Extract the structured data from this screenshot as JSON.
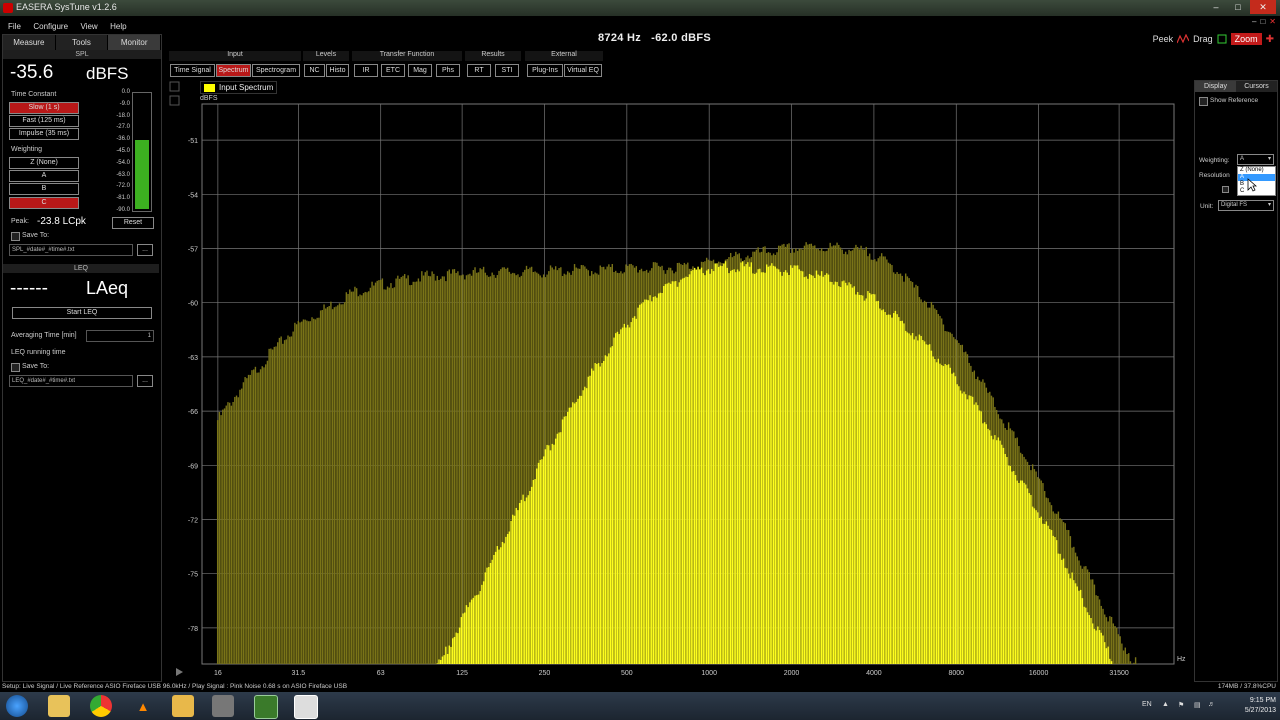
{
  "window": {
    "title": "EASERA SysTune v1.2.6"
  },
  "menu": [
    "File",
    "Configure",
    "View",
    "Help"
  ],
  "readout": {
    "freq": "8724 Hz",
    "level": "-62.0 dBFS"
  },
  "topright": {
    "peek": "Peek",
    "drag": "Drag",
    "zoom": "Zoom"
  },
  "left_tabs": [
    "Measure",
    "Tools",
    "Monitor"
  ],
  "spl": {
    "section": "SPL",
    "value": "-35.6",
    "unit": "dBFS",
    "time_constant_label": "Time Constant",
    "time_constants": [
      "Slow (1 s)",
      "Fast (125 ms)",
      "Impulse (35 ms)"
    ],
    "weighting_label": "Weighting",
    "weightings": [
      "Z (None)",
      "A",
      "B",
      "C"
    ],
    "peak_label": "Peak:",
    "peak_value": "-23.8 LCpk",
    "reset": "Reset",
    "save_to": "Save To:",
    "file": "SPL_#date#_#time#.txt",
    "browse": "...",
    "meter_ticks": [
      "0.0",
      "-9.0",
      "-18.0",
      "-27.0",
      "-36.0",
      "-45.0",
      "-54.0",
      "-63.0",
      "-72.0",
      "-81.0",
      "-90.0"
    ],
    "meter_level_dbfs": -35.6
  },
  "leq": {
    "section": "LEQ",
    "value": "------",
    "unit": "LAeq",
    "start": "Start LEQ",
    "avg_label": "Averaging Time [min]",
    "avg_value": "1",
    "running": "LEQ running time",
    "save_to": "Save To:",
    "file": "LEQ_#date#_#time#.txt",
    "browse": "..."
  },
  "toolbar": {
    "groups": [
      {
        "label": "Input",
        "buttons": [
          "Time Signal",
          "Spectrum",
          "Spectrogram"
        ],
        "active": "Spectrum"
      },
      {
        "label": "Levels",
        "buttons": [
          "NC",
          "Histo"
        ]
      },
      {
        "label": "Transfer Function",
        "buttons": [
          "IR",
          "ETC",
          "Mag",
          "Phs"
        ]
      },
      {
        "label": "Results",
        "buttons": [
          "RT",
          "STI"
        ]
      },
      {
        "label": "External",
        "buttons": [
          "Plug-Ins",
          "Virtual EQ"
        ]
      }
    ]
  },
  "legend": {
    "label": "Input Spectrum"
  },
  "chart_data": {
    "type": "bar",
    "ylabel": "dBFS",
    "xlabel": "Hz",
    "x_scale": "log",
    "xlim": [
      14,
      50000
    ],
    "ylim": [
      -80,
      -49
    ],
    "x_ticks": [
      "16",
      "31.5",
      "63",
      "125",
      "250",
      "500",
      "1000",
      "2000",
      "4000",
      "8000",
      "16000",
      "31500"
    ],
    "y_ticks": [
      "-51",
      "-54",
      "-57",
      "-60",
      "-63",
      "-66",
      "-69",
      "-72",
      "-75",
      "-78"
    ],
    "series": [
      {
        "color": "#7a7418",
        "x": [
          16,
          20,
          25,
          31.5,
          40,
          50,
          63,
          80,
          100,
          125,
          160,
          200,
          250,
          315,
          400,
          500,
          630,
          800,
          1000,
          1250,
          1600,
          2000,
          2500,
          3150,
          4000,
          5000,
          6300,
          8000,
          10000,
          12500,
          16000,
          20000,
          25000,
          31500,
          40000
        ],
        "values": [
          -66.5,
          -64.5,
          -62.8,
          -61.2,
          -60.3,
          -59.4,
          -59.0,
          -58.7,
          -58.5,
          -58.4,
          -58.3,
          -58.3,
          -58.3,
          -58.2,
          -58.2,
          -58.1,
          -58.1,
          -58.0,
          -57.8,
          -57.5,
          -57.2,
          -57.0,
          -56.9,
          -57.0,
          -57.3,
          -58.3,
          -60.0,
          -62.0,
          -64.5,
          -67.0,
          -69.8,
          -72.5,
          -75.5,
          -78.5,
          -81
        ]
      },
      {
        "color": "#ffff1e",
        "x": [
          63,
          80,
          100,
          125,
          160,
          200,
          250,
          315,
          400,
          500,
          630,
          800,
          1000,
          1250,
          1600,
          2000,
          2500,
          3150,
          4000,
          5000,
          6300,
          8000,
          10000,
          12500,
          16000,
          20000,
          25000,
          31500,
          40000
        ],
        "values": [
          -90,
          -84,
          -80.5,
          -77.5,
          -74.5,
          -71.5,
          -68.5,
          -65.8,
          -63.2,
          -61.2,
          -59.6,
          -58.6,
          -58.1,
          -58.0,
          -58.1,
          -58.2,
          -58.5,
          -59.0,
          -59.8,
          -61.0,
          -62.4,
          -64.2,
          -66.3,
          -68.8,
          -71.5,
          -74.3,
          -77.5,
          -80.5,
          -84
        ]
      }
    ]
  },
  "right_panel": {
    "tabs": [
      "Display",
      "Cursors"
    ],
    "show_reference": "Show Reference",
    "weighting_label": "Weighting:",
    "weighting_value": "A",
    "resolution_label": "Resolution",
    "unit_label": "Unit:",
    "unit_value": "Digital FS",
    "dropdown_options": [
      "Z (None)",
      "A",
      "B",
      "C"
    ],
    "dropdown_selected": "A"
  },
  "status": {
    "left": "Setup: Live Signal / Live Reference ASIO Fireface USB 96.0kHz / Play Signal : Pink Noise 0.68 s on ASIO Fireface USB",
    "right": "174MB / 37.8%CPU"
  },
  "taskbar": {
    "lang": "EN",
    "time": "9:15 PM",
    "date": "5/27/2013"
  }
}
